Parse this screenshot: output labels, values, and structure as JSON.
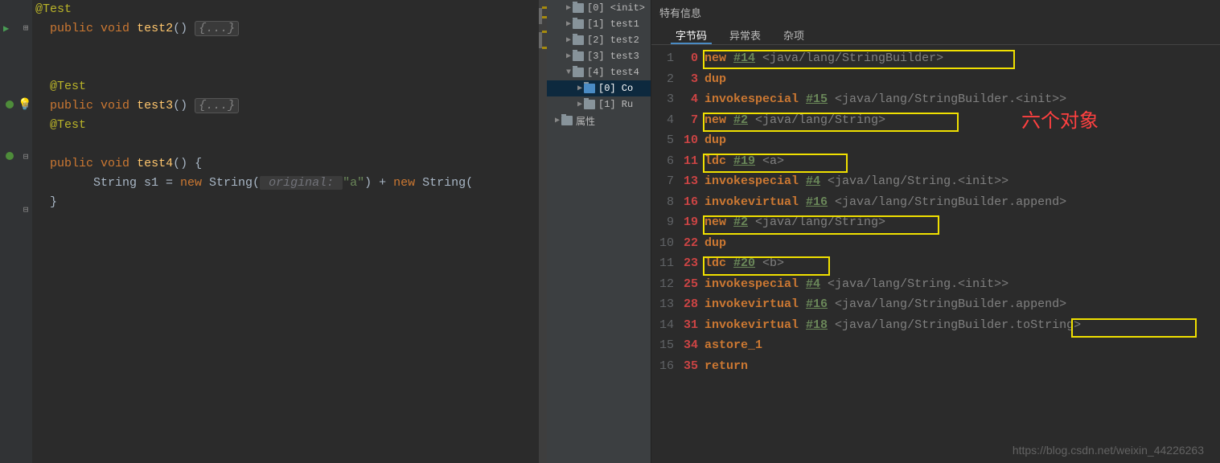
{
  "editor": {
    "lines": {
      "l0": "@Test",
      "l1_kw1": "public",
      "l1_kw2": "void",
      "l1_m": "test2",
      "l1_fold": "{...}",
      "l3": "@Test",
      "l4_kw1": "public",
      "l4_kw2": "void",
      "l4_m": "test3",
      "l4_fold": "{...}",
      "l5": "@Test",
      "l6_kw1": "public",
      "l6_kw2": "void",
      "l6_m": "test4",
      "l7_pre": "        String s1 = ",
      "l7_kw": "new",
      "l7_cls": " String(",
      "l7_p": " original: ",
      "l7_str": "\"a\"",
      "l7_mid": ") + ",
      "l7_kw2": "new",
      "l7_cls2": " String(",
      "l8": "}"
    }
  },
  "tree": {
    "items": [
      {
        "indent": 14,
        "arrow": "▶",
        "label": "[0] <init>"
      },
      {
        "indent": 14,
        "arrow": "▶",
        "label": "[1] test1"
      },
      {
        "indent": 14,
        "arrow": "▶",
        "label": "[2] test2"
      },
      {
        "indent": 14,
        "arrow": "▶",
        "label": "[3] test3"
      },
      {
        "indent": 14,
        "arrow": "▼",
        "label": "[4] test4"
      },
      {
        "indent": 28,
        "arrow": "▶",
        "label": "[0] Co",
        "sel": true
      },
      {
        "indent": 28,
        "arrow": "▶",
        "label": "[1] Ru"
      },
      {
        "indent": 0,
        "arrow": "▶",
        "label": "属性"
      }
    ]
  },
  "bytecode": {
    "header": "特有信息",
    "tabs": [
      "字节码",
      "异常表",
      "杂项"
    ],
    "lines": [
      {
        "ln": "1",
        "off": "0",
        "parts": [
          {
            "t": "op",
            "v": "new "
          },
          {
            "t": "ref",
            "v": "#14"
          },
          {
            "t": "cls",
            "v": " <java/lang/StringBuilder>"
          }
        ]
      },
      {
        "ln": "2",
        "off": "3",
        "parts": [
          {
            "t": "op",
            "v": "dup"
          }
        ]
      },
      {
        "ln": "3",
        "off": "4",
        "parts": [
          {
            "t": "op",
            "v": "invokespecial "
          },
          {
            "t": "ref",
            "v": "#15"
          },
          {
            "t": "cls",
            "v": " <java/lang/StringBuilder.<init>>"
          }
        ]
      },
      {
        "ln": "4",
        "off": "7",
        "parts": [
          {
            "t": "op",
            "v": "new "
          },
          {
            "t": "ref",
            "v": "#2"
          },
          {
            "t": "cls",
            "v": " <java/lang/String>"
          }
        ]
      },
      {
        "ln": "5",
        "off": "10",
        "parts": [
          {
            "t": "op",
            "v": "dup"
          }
        ]
      },
      {
        "ln": "6",
        "off": "11",
        "parts": [
          {
            "t": "op",
            "v": "ldc "
          },
          {
            "t": "ref",
            "v": "#19"
          },
          {
            "t": "cls",
            "v": " <a>"
          }
        ]
      },
      {
        "ln": "7",
        "off": "13",
        "parts": [
          {
            "t": "op",
            "v": "invokespecial "
          },
          {
            "t": "ref",
            "v": "#4"
          },
          {
            "t": "cls",
            "v": " <java/lang/String.<init>>"
          }
        ]
      },
      {
        "ln": "8",
        "off": "16",
        "parts": [
          {
            "t": "op",
            "v": "invokevirtual "
          },
          {
            "t": "ref",
            "v": "#16"
          },
          {
            "t": "cls",
            "v": " <java/lang/StringBuilder.append>"
          }
        ]
      },
      {
        "ln": "9",
        "off": "19",
        "parts": [
          {
            "t": "op",
            "v": "new "
          },
          {
            "t": "ref",
            "v": "#2"
          },
          {
            "t": "cls",
            "v": " <java/lang/String>"
          }
        ]
      },
      {
        "ln": "10",
        "off": "22",
        "parts": [
          {
            "t": "op",
            "v": "dup"
          }
        ]
      },
      {
        "ln": "11",
        "off": "23",
        "parts": [
          {
            "t": "op",
            "v": "ldc "
          },
          {
            "t": "ref",
            "v": "#20"
          },
          {
            "t": "cls",
            "v": " <b>"
          }
        ]
      },
      {
        "ln": "12",
        "off": "25",
        "parts": [
          {
            "t": "op",
            "v": "invokespecial "
          },
          {
            "t": "ref",
            "v": "#4"
          },
          {
            "t": "cls",
            "v": " <java/lang/String.<init>>"
          }
        ]
      },
      {
        "ln": "13",
        "off": "28",
        "parts": [
          {
            "t": "op",
            "v": "invokevirtual "
          },
          {
            "t": "ref",
            "v": "#16"
          },
          {
            "t": "cls",
            "v": " <java/lang/StringBuilder.append>"
          }
        ]
      },
      {
        "ln": "14",
        "off": "31",
        "parts": [
          {
            "t": "op",
            "v": "invokevirtual "
          },
          {
            "t": "ref",
            "v": "#18"
          },
          {
            "t": "cls",
            "v": " <java/lang/StringBuilder.toString>"
          }
        ]
      },
      {
        "ln": "15",
        "off": "34",
        "parts": [
          {
            "t": "op",
            "v": "astore_1"
          }
        ]
      },
      {
        "ln": "16",
        "off": "35",
        "parts": [
          {
            "t": "op",
            "v": "return"
          }
        ]
      }
    ]
  },
  "annotation": "六个对象",
  "watermark": "https://blog.csdn.net/weixin_44226263"
}
